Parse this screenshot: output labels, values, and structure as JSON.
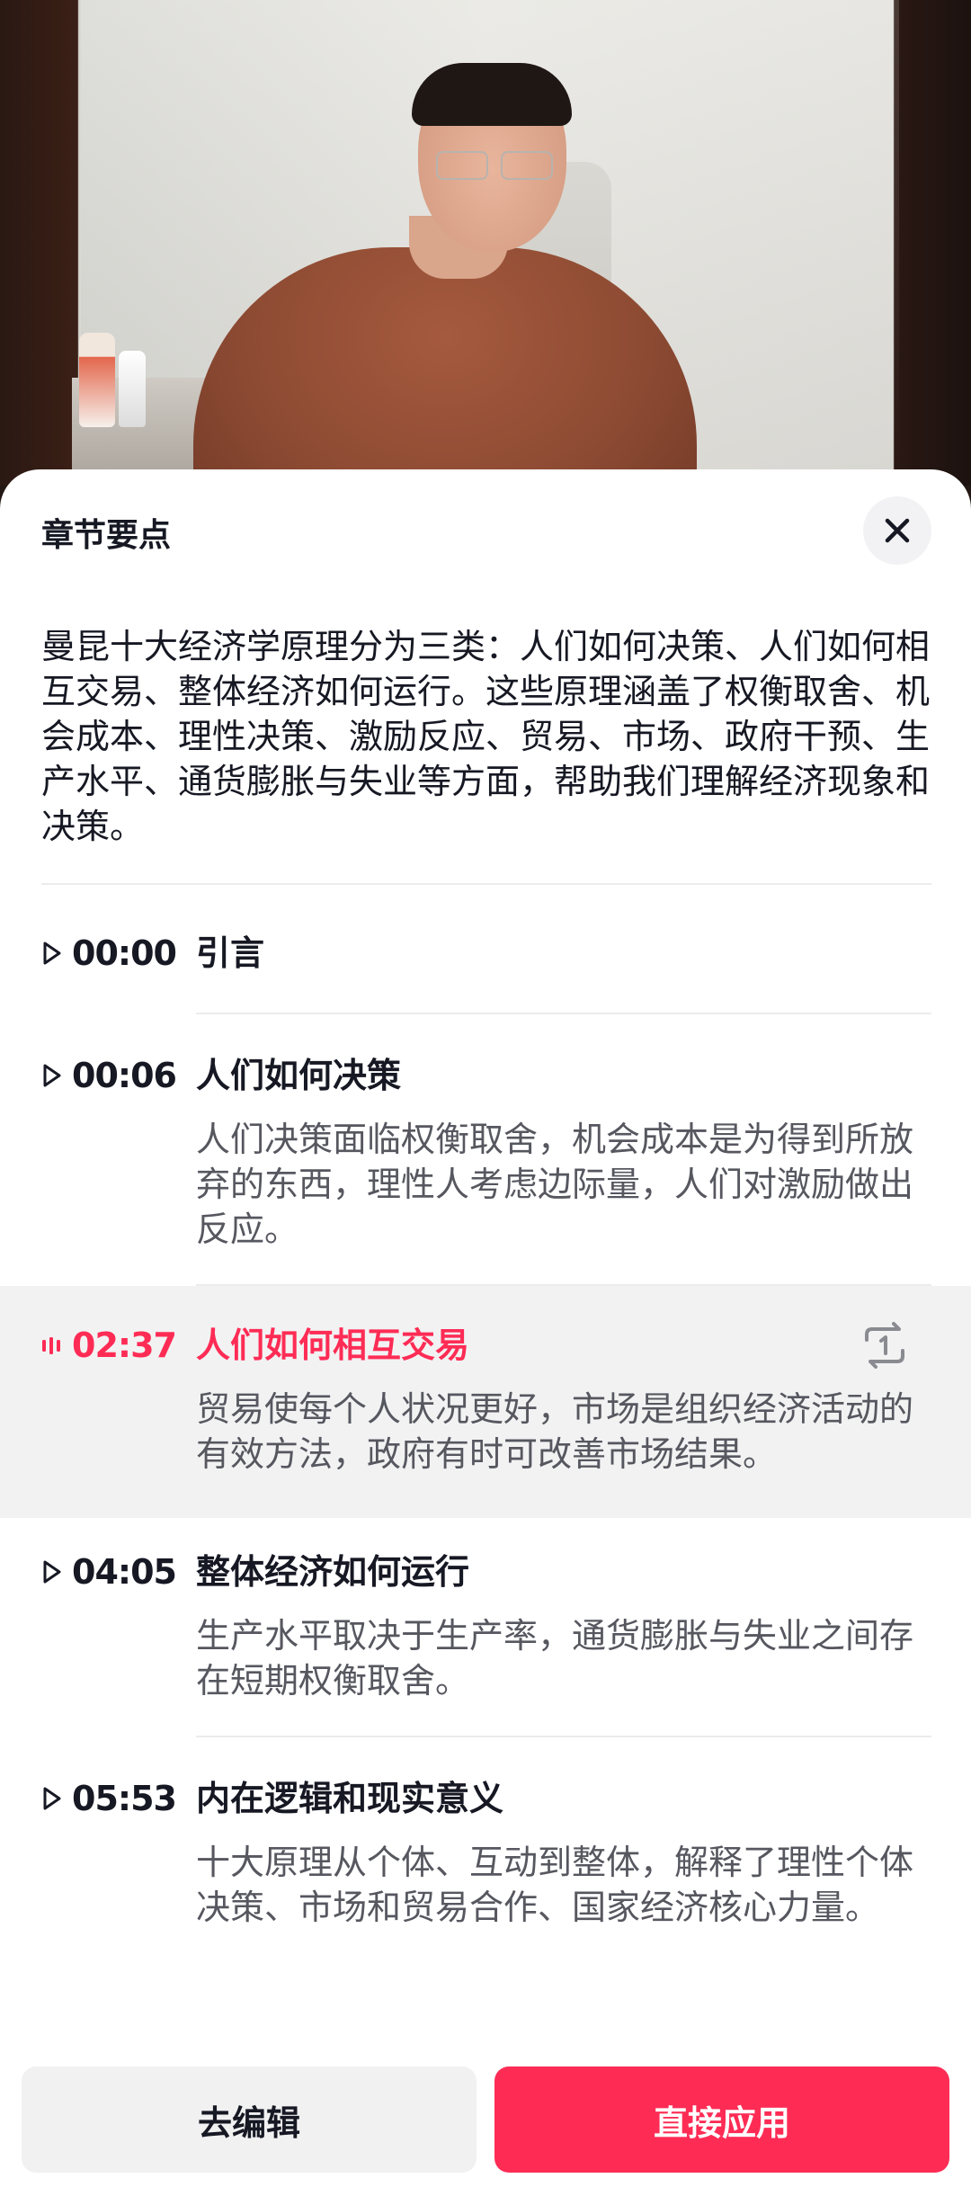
{
  "sheet": {
    "title": "章节要点",
    "summary": "曼昆十大经济学原理分为三类：人们如何决策、人们如何相互交易、整体经济如何运行。这些原理涵盖了权衡取舍、机会成本、理性决策、激励反应、贸易、市场、政府干预、生产水平、通货膨胀与失业等方面，帮助我们理解经济现象和决策。"
  },
  "chapters": [
    {
      "time": "00:00",
      "title": "引言",
      "desc": ""
    },
    {
      "time": "00:06",
      "title": "人们如何决策",
      "desc": "人们决策面临权衡取舍，机会成本是为得到所放弃的东西，理性人考虑边际量，人们对激励做出反应。"
    },
    {
      "time": "02:37",
      "title": "人们如何相互交易",
      "desc": "贸易使每个人状况更好，市场是组织经济活动的有效方法，政府有时可改善市场结果。"
    },
    {
      "time": "04:05",
      "title": "整体经济如何运行",
      "desc": "生产水平取决于生产率，通货膨胀与失业之间存在短期权衡取舍。"
    },
    {
      "time": "05:53",
      "title": "内在逻辑和现实意义",
      "desc": "十大原理从个体、互动到整体，解释了理性个体决策、市场和贸易合作、国家经济核心力量。"
    }
  ],
  "buttons": {
    "edit": "去编辑",
    "apply": "直接应用"
  },
  "colors": {
    "accent": "#fe2c55",
    "active_bg": "#f2f2f3",
    "text": "#161823",
    "secondary_text": "#56575f"
  },
  "icons": {
    "close": "close-icon",
    "play": "play-triangle-icon",
    "playing": "sound-wave-icon",
    "loop": "loop-once-icon"
  }
}
